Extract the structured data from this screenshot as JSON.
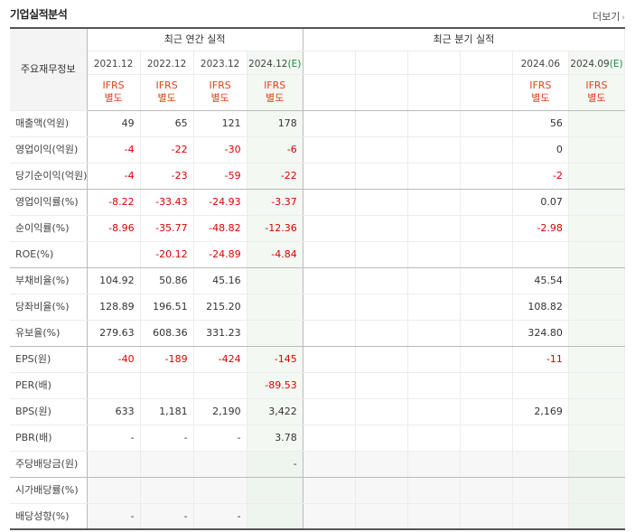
{
  "header": {
    "title": "기업실적분석",
    "more": "더보기"
  },
  "table": {
    "label_head": "주요재무정보",
    "annual_head": "최근 연간 실적",
    "quarter_head": "최근 분기 실적",
    "annual_periods": [
      "2021.12",
      "2022.12",
      "2023.12",
      "2024.12(E)"
    ],
    "quarter_periods": [
      "",
      "",
      "",
      "",
      "2024.06",
      "2024.09(E)"
    ],
    "ifrs_label": "IFRS",
    "basis_label": "별도",
    "rows": [
      {
        "label": "매출액(억원)",
        "annual": [
          "49",
          "65",
          "121",
          "178"
        ],
        "quarter": [
          "",
          "",
          "",
          "",
          "56",
          ""
        ]
      },
      {
        "label": "영업이익(억원)",
        "annual": [
          "-4",
          "-22",
          "-30",
          "-6"
        ],
        "quarter": [
          "",
          "",
          "",
          "",
          "0",
          ""
        ]
      },
      {
        "label": "당기순이익(억원)",
        "annual": [
          "-4",
          "-23",
          "-59",
          "-22"
        ],
        "quarter": [
          "",
          "",
          "",
          "",
          "-2",
          ""
        ]
      },
      {
        "label": "영업이익률(%)",
        "annual": [
          "-8.22",
          "-33.43",
          "-24.93",
          "-3.37"
        ],
        "quarter": [
          "",
          "",
          "",
          "",
          "0.07",
          ""
        ]
      },
      {
        "label": "순이익률(%)",
        "annual": [
          "-8.96",
          "-35.77",
          "-48.82",
          "-12.36"
        ],
        "quarter": [
          "",
          "",
          "",
          "",
          "-2.98",
          ""
        ]
      },
      {
        "label": "ROE(%)",
        "annual": [
          "",
          "-20.12",
          "-24.89",
          "-4.84"
        ],
        "quarter": [
          "",
          "",
          "",
          "",
          "",
          ""
        ]
      },
      {
        "label": "부채비율(%)",
        "annual": [
          "104.92",
          "50.86",
          "45.16",
          ""
        ],
        "quarter": [
          "",
          "",
          "",
          "",
          "45.54",
          ""
        ]
      },
      {
        "label": "당좌비율(%)",
        "annual": [
          "128.89",
          "196.51",
          "215.20",
          ""
        ],
        "quarter": [
          "",
          "",
          "",
          "",
          "108.82",
          ""
        ]
      },
      {
        "label": "유보율(%)",
        "annual": [
          "279.63",
          "608.36",
          "331.23",
          ""
        ],
        "quarter": [
          "",
          "",
          "",
          "",
          "324.80",
          ""
        ]
      },
      {
        "label": "EPS(원)",
        "annual": [
          "-40",
          "-189",
          "-424",
          "-145"
        ],
        "quarter": [
          "",
          "",
          "",
          "",
          "-11",
          ""
        ]
      },
      {
        "label": "PER(배)",
        "annual": [
          "",
          "",
          "",
          "-89.53"
        ],
        "quarter": [
          "",
          "",
          "",
          "",
          "",
          ""
        ]
      },
      {
        "label": "BPS(원)",
        "annual": [
          "633",
          "1,181",
          "2,190",
          "3,422"
        ],
        "quarter": [
          "",
          "",
          "",
          "",
          "2,169",
          ""
        ]
      },
      {
        "label": "PBR(배)",
        "annual": [
          "-",
          "-",
          "-",
          "3.78"
        ],
        "quarter": [
          "",
          "",
          "",
          "",
          "",
          ""
        ]
      },
      {
        "label": "주당배당금(원)",
        "annual": [
          "",
          "",
          "",
          "-"
        ],
        "quarter": [
          "",
          "",
          "",
          "",
          "",
          ""
        ]
      },
      {
        "label": "시가배당률(%)",
        "annual": [
          "",
          "",
          "",
          ""
        ],
        "quarter": [
          "",
          "",
          "",
          "",
          "",
          ""
        ]
      },
      {
        "label": "배당성향(%)",
        "annual": [
          "-",
          "-",
          "-",
          ""
        ],
        "quarter": [
          "",
          "",
          "",
          "",
          "",
          ""
        ]
      }
    ]
  }
}
